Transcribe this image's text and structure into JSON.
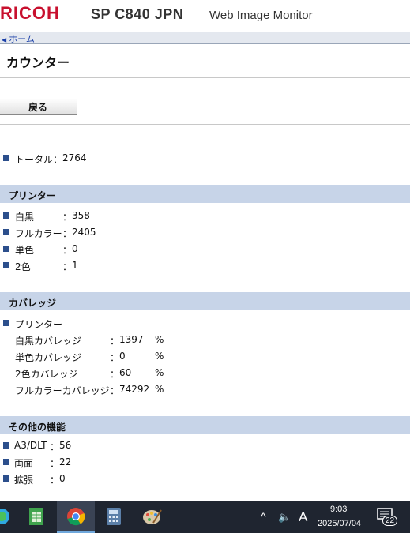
{
  "header": {
    "brand": "RICOH",
    "model": "SP C840 JPN",
    "product": "Web Image Monitor",
    "brand_color": "#c8102e"
  },
  "nav": {
    "home_link": "ホーム"
  },
  "page": {
    "title": "カウンター",
    "back_button": "戻る"
  },
  "total": {
    "label": "トータル",
    "value": "2764"
  },
  "printer": {
    "heading": "プリンター",
    "items": [
      {
        "label": "白黒",
        "value": "358"
      },
      {
        "label": "フルカラー",
        "value": "2405"
      },
      {
        "label": "単色",
        "value": "0"
      },
      {
        "label": "2色",
        "value": "1"
      }
    ]
  },
  "coverage": {
    "heading": "カバレッジ",
    "group_label": "プリンター",
    "items": [
      {
        "label": "白黒カバレッジ",
        "value": "1397",
        "unit": "%"
      },
      {
        "label": "単色カバレッジ",
        "value": "0",
        "unit": "%"
      },
      {
        "label": "2色カバレッジ",
        "value": "60",
        "unit": "%"
      },
      {
        "label": "フルカラーカバレッジ",
        "value": "74292",
        "unit": "%"
      }
    ]
  },
  "other": {
    "heading": "その他の機能",
    "items": [
      {
        "label": "A3/DLT",
        "value": "56"
      },
      {
        "label": "両面",
        "value": "22"
      },
      {
        "label": "拡張",
        "value": "0"
      }
    ]
  },
  "taskbar": {
    "time": "9:03",
    "date": "2025/07/04",
    "ime": "A",
    "notification_count": "22",
    "apps": [
      "edge-icon",
      "spreadsheet-icon",
      "chrome-icon",
      "calculator-icon",
      "paint-icon"
    ]
  },
  "colors": {
    "section_bg": "#c7d4e8",
    "bullet": "#2c4f8c",
    "link": "#1a3fa8"
  }
}
